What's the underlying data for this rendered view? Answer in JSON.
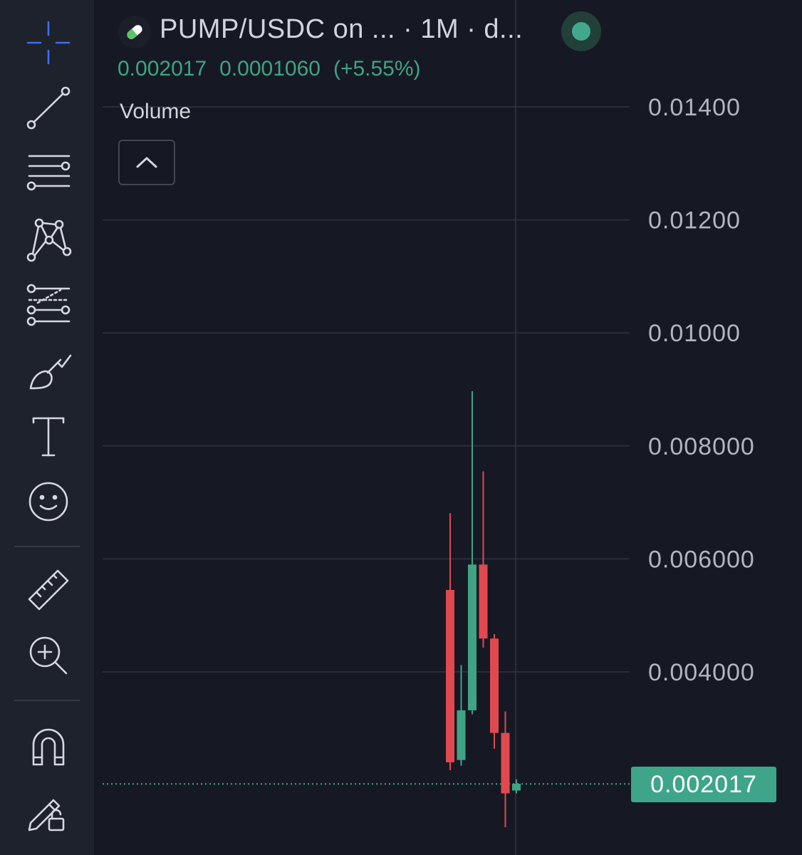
{
  "header": {
    "pair_title": "PUMP/USDC on ...  · 1M · d...",
    "pair_icon": "pill-icon",
    "status_color": "#42a88c"
  },
  "price_row": {
    "last": "0.002017",
    "change": "0.0001060",
    "change_pct": "(+5.55%)",
    "color": "#3fa384"
  },
  "volume": {
    "label": "Volume",
    "toggle_icon": "chevron-up-icon"
  },
  "toolbar": {
    "tools": [
      "crosshair-icon",
      "trend-line-icon",
      "horizontal-lines-icon",
      "pattern-icon",
      "fib-retracement-icon",
      "brush-icon",
      "text-icon",
      "emoji-icon",
      "ruler-icon",
      "zoom-in-icon",
      "magnet-icon",
      "lock-drawing-icon"
    ]
  },
  "last_price_label": "0.002017",
  "chart_data": {
    "type": "candlestick",
    "y_axis": {
      "ticks": [
        {
          "value": 0.014,
          "label": "0.01400"
        },
        {
          "value": 0.012,
          "label": "0.01200"
        },
        {
          "value": 0.01,
          "label": "0.01000"
        },
        {
          "value": 0.008,
          "label": "0.008000"
        },
        {
          "value": 0.006,
          "label": "0.006000"
        },
        {
          "value": 0.004,
          "label": "0.004000"
        }
      ],
      "range": [
        0.0,
        0.01524
      ]
    },
    "grid": true,
    "last_price": 0.002017,
    "up_color": "#3fa384",
    "down_color": "#e0494f",
    "candles": [
      {
        "open": 0.00545,
        "high": 0.00681,
        "low": 0.00226,
        "close": 0.0024
      },
      {
        "open": 0.00244,
        "high": 0.00412,
        "low": 0.00234,
        "close": 0.00332
      },
      {
        "open": 0.00332,
        "high": 0.00897,
        "low": 0.00325,
        "close": 0.0059
      },
      {
        "open": 0.0059,
        "high": 0.00755,
        "low": 0.00443,
        "close": 0.00459
      },
      {
        "open": 0.00459,
        "high": 0.00467,
        "low": 0.00264,
        "close": 0.00292
      },
      {
        "open": 0.00292,
        "high": 0.0033,
        "low": 0.00125,
        "close": 0.00185
      },
      {
        "open": 0.0019,
        "high": 0.0021,
        "low": 0.00185,
        "close": 0.00202
      }
    ]
  }
}
